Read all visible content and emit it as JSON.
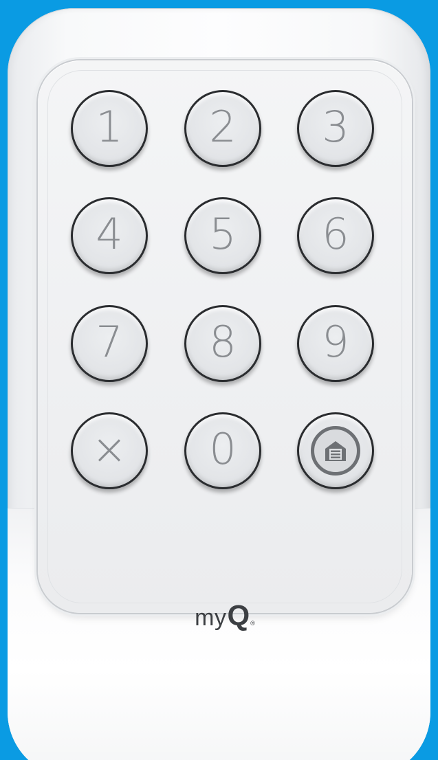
{
  "keypad": {
    "keys": [
      {
        "label": "1"
      },
      {
        "label": "2"
      },
      {
        "label": "3"
      },
      {
        "label": "4"
      },
      {
        "label": "5"
      },
      {
        "label": "6"
      },
      {
        "label": "7"
      },
      {
        "label": "8"
      },
      {
        "label": "9"
      },
      {
        "label": "×"
      },
      {
        "label": "0"
      },
      {
        "icon": "garage-door-icon"
      }
    ]
  },
  "brand": {
    "my": "my",
    "q": "Q",
    "registered": "®"
  },
  "colors": {
    "background": "#0a9be3",
    "device": "#f7f8f9",
    "key_ring": "#2a2c2f",
    "key_label": "#8a8d91"
  }
}
